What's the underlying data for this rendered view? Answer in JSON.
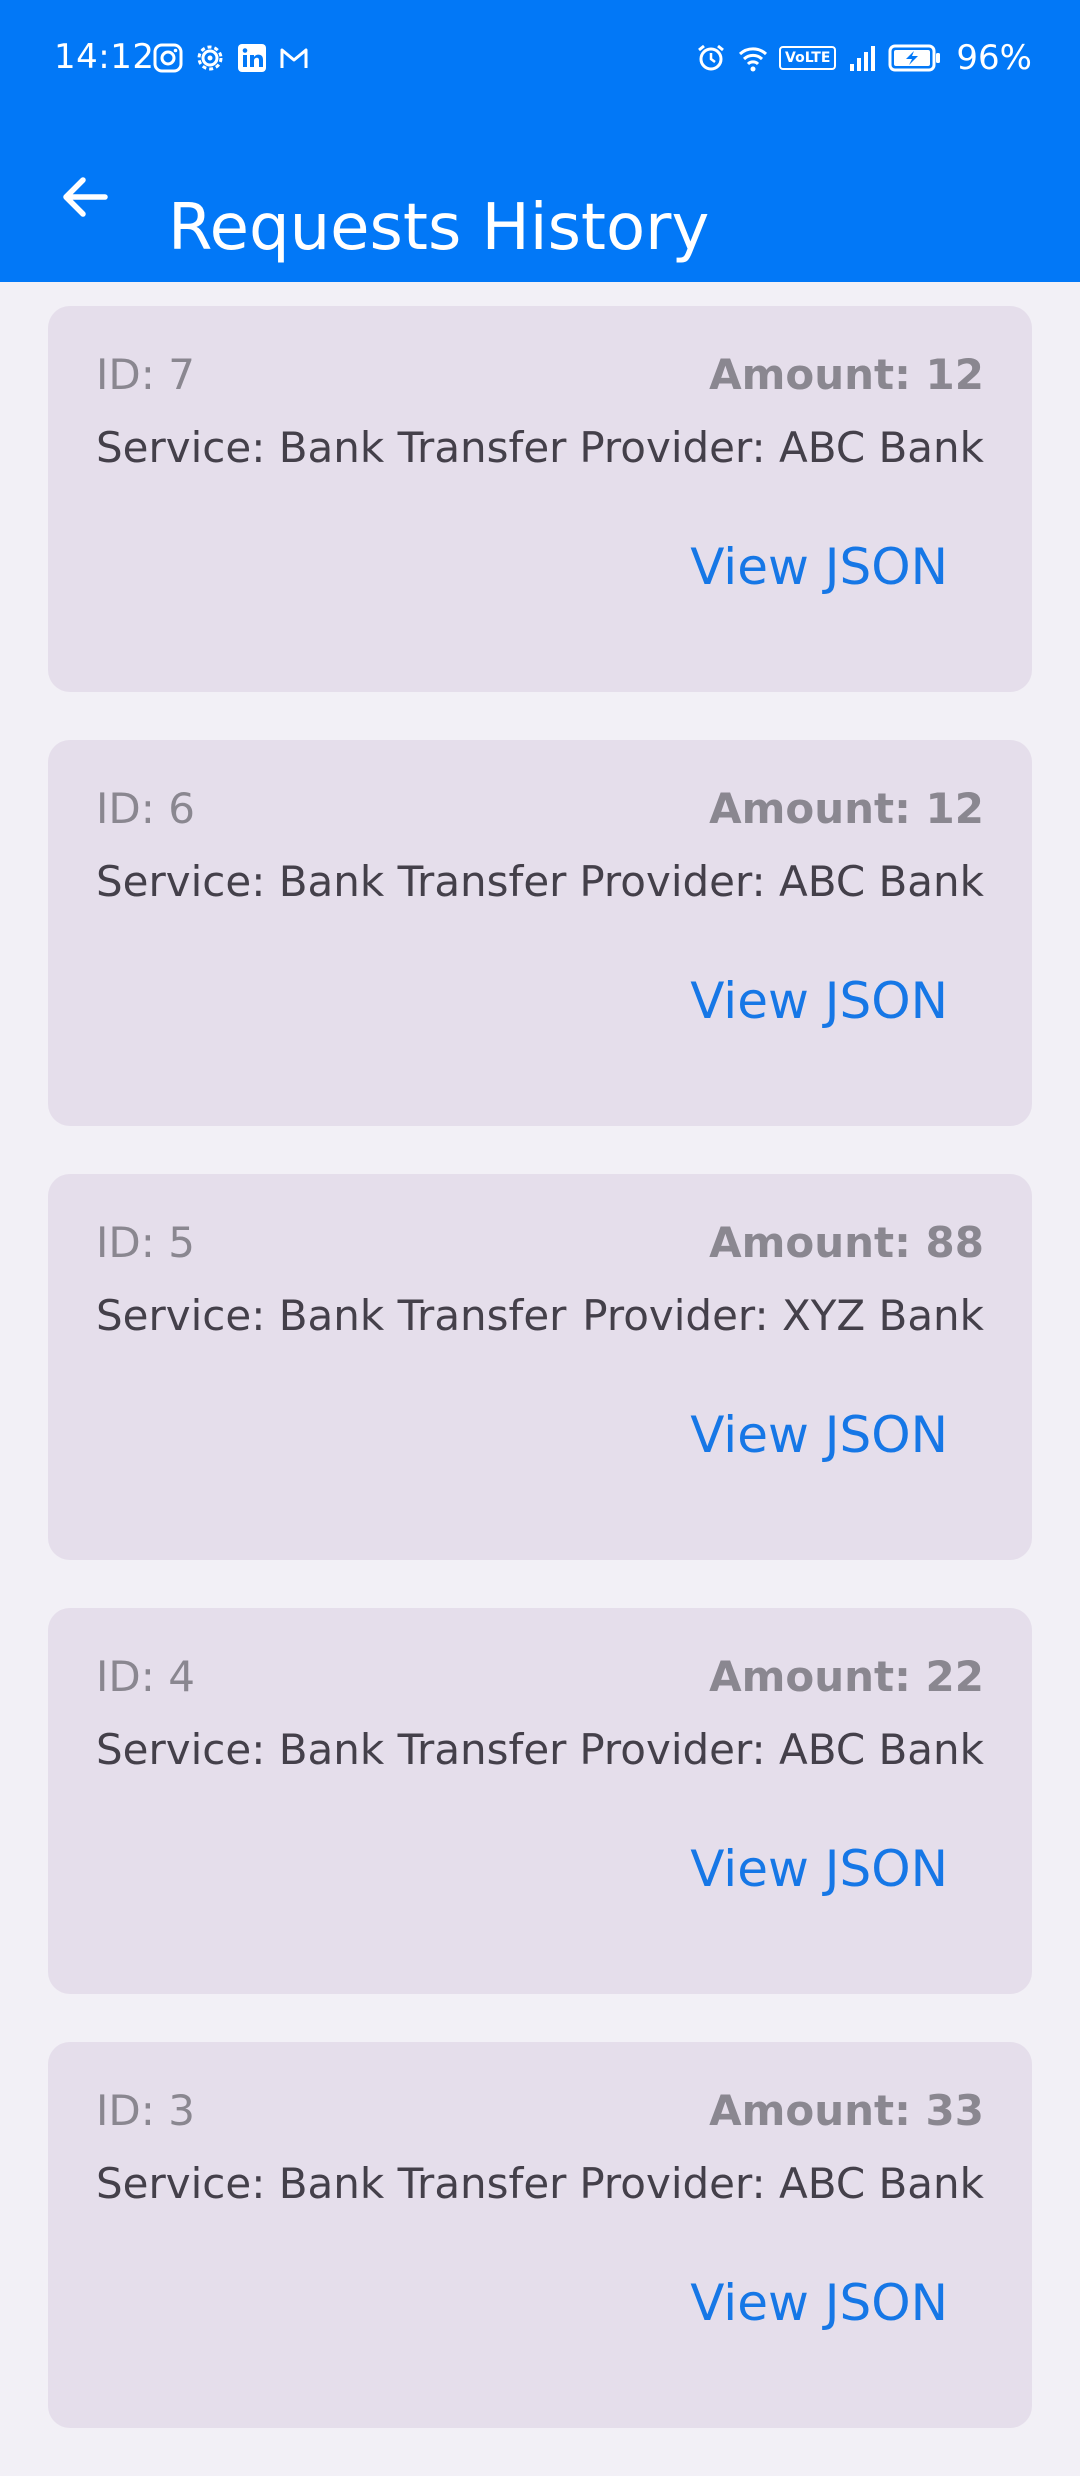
{
  "status_bar": {
    "time": "14:12",
    "notification_icons": [
      "instagram-icon",
      "settings-gear-icon",
      "linkedin-icon",
      "gmail-icon"
    ],
    "system_icons": [
      "alarm-icon",
      "wifi-icon",
      "volte-icon",
      "signal-icon",
      "battery-charging-icon"
    ],
    "volte_label": "VoLTE",
    "battery_percent": "96%"
  },
  "toolbar": {
    "title": "Requests History",
    "back_icon": "arrow-back-icon",
    "background": "#0278F7"
  },
  "requests": [
    {
      "id": "ID: 7",
      "amount": "Amount: 12",
      "service": "Service: Bank Transfer",
      "provider": "Provider: ABC Bank",
      "action": "View JSON"
    },
    {
      "id": "ID: 6",
      "amount": "Amount: 12",
      "service": "Service: Bank Transfer",
      "provider": "Provider: ABC Bank",
      "action": "View JSON"
    },
    {
      "id": "ID: 5",
      "amount": "Amount: 88",
      "service": "Service: Bank Transfer",
      "provider": "Provider: XYZ Bank",
      "action": "View JSON"
    },
    {
      "id": "ID: 4",
      "amount": "Amount: 22",
      "service": "Service: Bank Transfer",
      "provider": "Provider: ABC Bank",
      "action": "View JSON"
    },
    {
      "id": "ID: 3",
      "amount": "Amount: 33",
      "service": "Service: Bank Transfer",
      "provider": "Provider: ABC Bank",
      "action": "View JSON"
    }
  ],
  "colors": {
    "accent": "#1677E6",
    "card_background": "#E5DEEB",
    "page_background": "#F2F0F6"
  }
}
